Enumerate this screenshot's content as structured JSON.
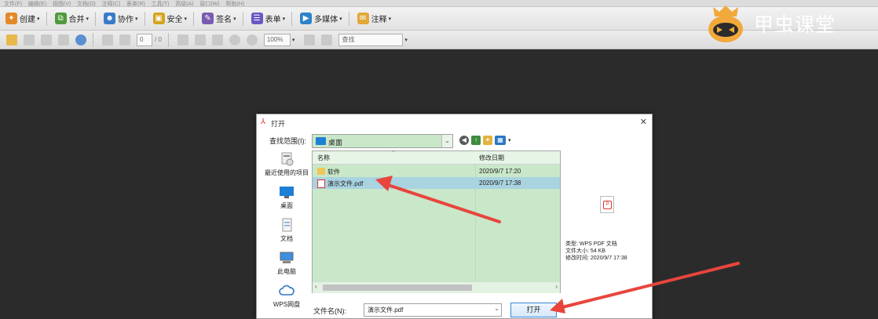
{
  "menu": {
    "items": [
      "文件(F)",
      "编辑(E)",
      "视图(V)",
      "文档(D)",
      "注释(C)",
      "表单(R)",
      "工具(T)",
      "高级(A)",
      "窗口(W)",
      "帮助(H)"
    ]
  },
  "toolbar": {
    "buttons": [
      {
        "label": "创建",
        "icon": "create-icon"
      },
      {
        "label": "合并",
        "icon": "merge-icon"
      },
      {
        "label": "协作",
        "icon": "collaborate-icon"
      },
      {
        "label": "安全",
        "icon": "lock-icon"
      },
      {
        "label": "签名",
        "icon": "sign-icon"
      },
      {
        "label": "表单",
        "icon": "form-icon"
      },
      {
        "label": "多媒体",
        "icon": "multimedia-icon"
      },
      {
        "label": "注释",
        "icon": "comment-icon"
      }
    ]
  },
  "toolbar2": {
    "page_current": "0",
    "page_total": "/ 0",
    "zoom": "100%",
    "search_placeholder": "查找"
  },
  "brand": {
    "text": "甲虫课堂",
    "colors": {
      "logo": "#f2a93b",
      "text": "#ffffff"
    }
  },
  "dialog": {
    "title": "打开",
    "look_in_label": "查找范围(I):",
    "look_in_value": "桌面",
    "places": [
      "最近使用的项目",
      "桌面",
      "文档",
      "此电脑",
      "WPS网盘"
    ],
    "columns": {
      "name": "名称",
      "date": "修改日期"
    },
    "files": [
      {
        "name": "软件",
        "date": "2020/9/7 17:20",
        "type": "folder",
        "selected": false
      },
      {
        "name": "演示文件.pdf",
        "date": "2020/9/7 17:38",
        "type": "pdf",
        "selected": true
      }
    ],
    "preview": {
      "type_label": "类型: WPS PDF 文档",
      "size_label": "文件大小: 54 KB",
      "modified_label": "修改时间: 2020/9/7 17:38"
    },
    "filename_label": "文件名(N):",
    "filename_value": "演示文件.pdf",
    "open_button": "打开",
    "colors": {
      "list_bg": "#c9e8c9",
      "selection": "#a9d3e0"
    }
  },
  "annotation": {
    "arrow_color": "#e8453c"
  }
}
